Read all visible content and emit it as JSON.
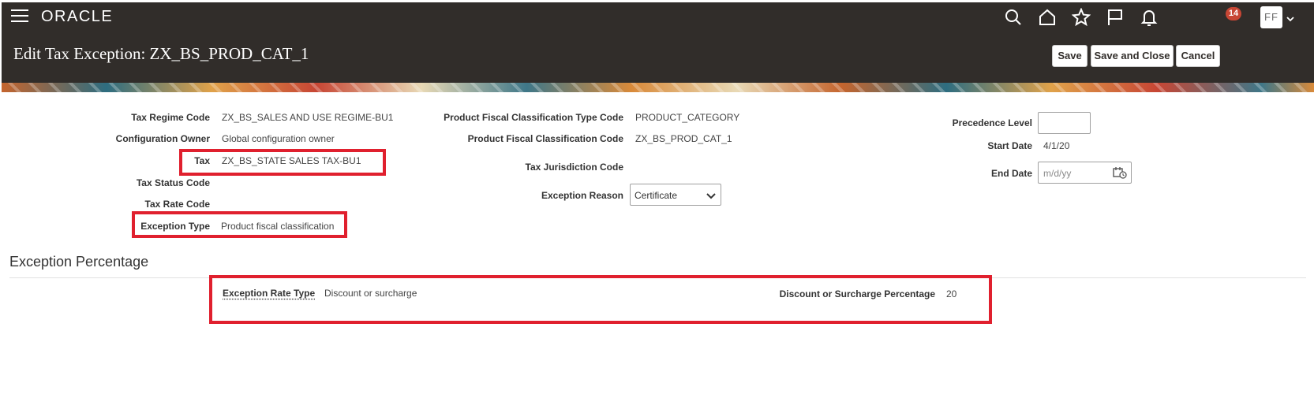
{
  "topbar": {
    "logo": "ORACLE",
    "icons": [
      "search-icon",
      "home-icon",
      "star-icon",
      "flag-icon",
      "bell-icon"
    ],
    "notification_count": "14",
    "user_initials": "FF"
  },
  "header": {
    "title": "Edit Tax Exception: ZX_BS_PROD_CAT_1",
    "buttons": {
      "save": "Save",
      "save_and_close": "Save and Close",
      "cancel": "Cancel"
    }
  },
  "form": {
    "left": [
      {
        "label": "Tax Regime Code",
        "value": "ZX_BS_SALES AND USE REGIME-BU1"
      },
      {
        "label": "Configuration Owner",
        "value": "Global configuration owner"
      },
      {
        "label": "Tax",
        "value": "ZX_BS_STATE SALES TAX-BU1"
      },
      {
        "label": "Tax Status Code",
        "value": ""
      },
      {
        "label": "Tax Rate Code",
        "value": ""
      },
      {
        "label": "Exception Type",
        "value": "Product fiscal classification"
      }
    ],
    "middle": {
      "pfc_type_code_label": "Product Fiscal Classification Type Code",
      "pfc_type_code_value": "PRODUCT_CATEGORY",
      "pfc_code_label": "Product Fiscal Classification Code",
      "pfc_code_value": "ZX_BS_PROD_CAT_1",
      "jurisdiction_label": "Tax Jurisdiction Code",
      "jurisdiction_value": "",
      "reason_label": "Exception Reason",
      "reason_value": "Certificate"
    },
    "right": {
      "precedence_label": "Precedence Level",
      "precedence_value": "",
      "start_date_label": "Start Date",
      "start_date_value": "4/1/20",
      "end_date_label": "End Date",
      "end_date_placeholder": "m/d/yy"
    }
  },
  "exception_percentage": {
    "section_title": "Exception Percentage",
    "rate_type_label": "Exception Rate Type",
    "rate_type_value": "Discount or surcharge",
    "percentage_label": "Discount or Surcharge Percentage",
    "percentage_value": "20"
  },
  "colors": {
    "topbar": "#312d2a",
    "highlight": "#e0202e",
    "badge": "#c74634"
  }
}
